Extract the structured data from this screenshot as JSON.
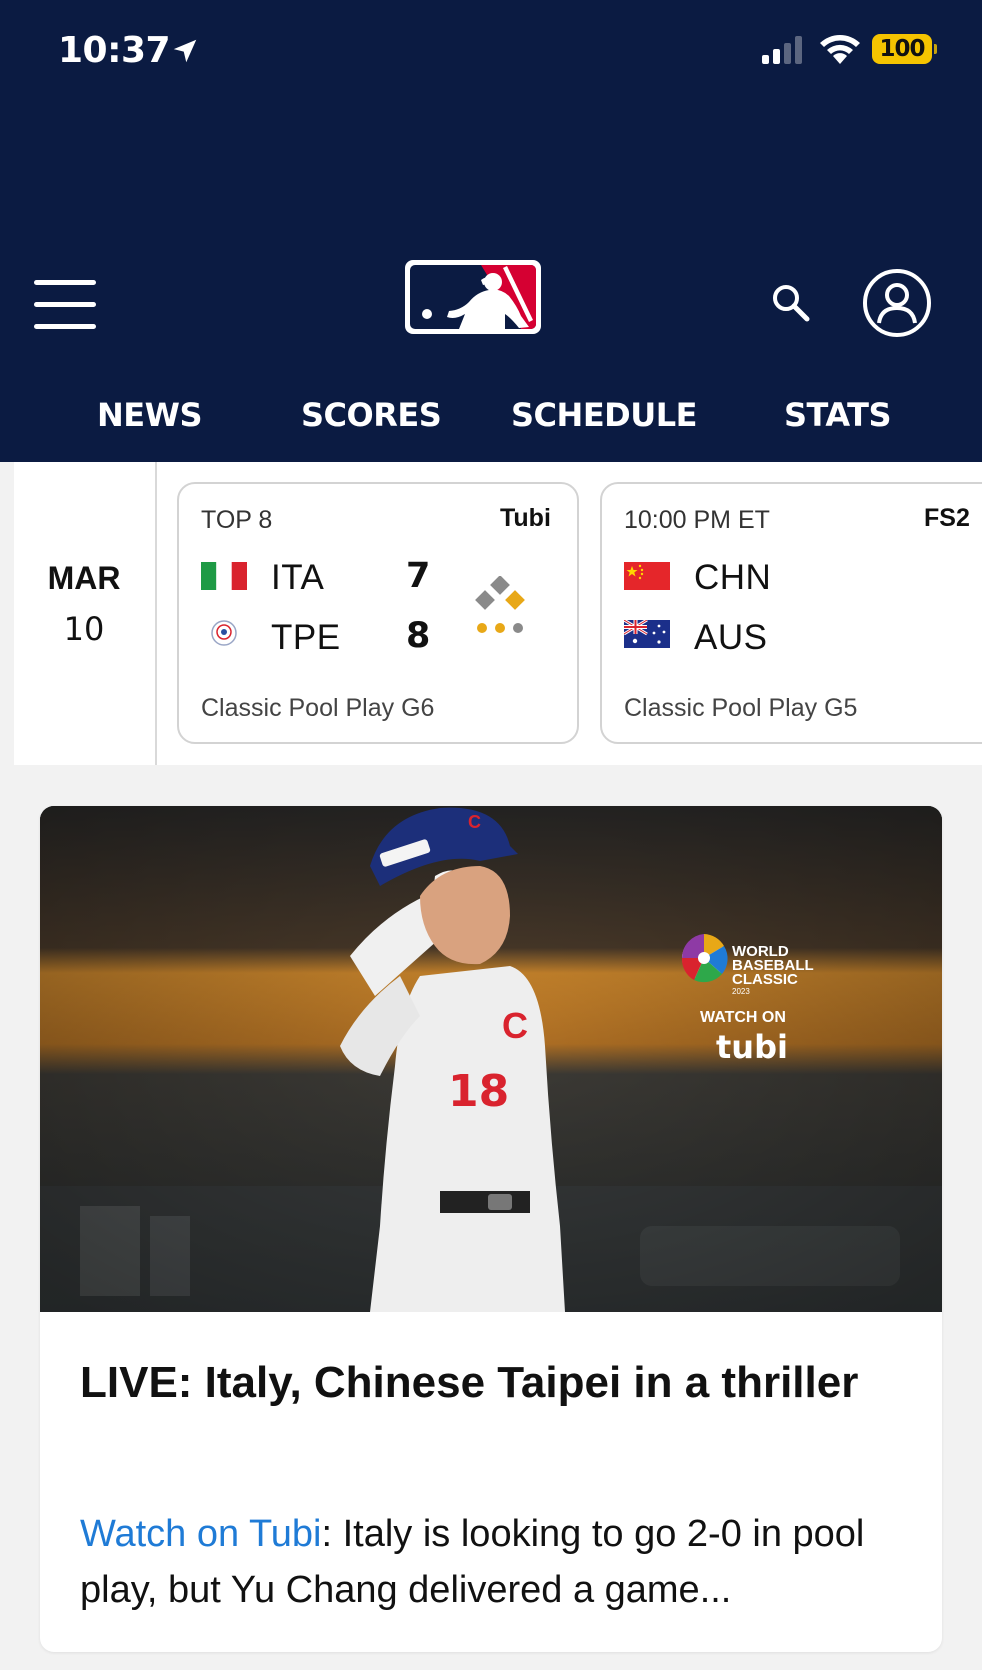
{
  "status_bar": {
    "time": "10:37",
    "battery": "100"
  },
  "nav": {
    "tabs": [
      {
        "label": "NEWS"
      },
      {
        "label": "SCORES"
      },
      {
        "label": "SCHEDULE"
      },
      {
        "label": "STATS"
      }
    ]
  },
  "scoreboard": {
    "date": {
      "month": "MAR",
      "day": "10"
    },
    "games": [
      {
        "status": "TOP 8",
        "network": "Tubi",
        "teams": [
          {
            "abbr": "ITA",
            "score": "7",
            "flag": "italy-flag-icon"
          },
          {
            "abbr": "TPE",
            "score": "8",
            "flag": "chinese-taipei-flag-icon"
          }
        ],
        "footer": "Classic Pool Play G6",
        "bases": {
          "first": false,
          "second": false,
          "third": true
        },
        "outs": 2
      },
      {
        "status": "10:00 PM ET",
        "network": "FS2",
        "teams": [
          {
            "abbr": "CHN",
            "score": "",
            "flag": "china-flag-icon"
          },
          {
            "abbr": "AUS",
            "score": "",
            "flag": "australia-flag-icon"
          }
        ],
        "footer": "Classic Pool Play G5"
      }
    ]
  },
  "article": {
    "hero_overlay": {
      "brand_line1": "WORLD",
      "brand_line2": "BASEBALL",
      "brand_line3": "CLASSIC",
      "brand_year": "2023",
      "watch_on": "WATCH ON",
      "service": "tubi",
      "jersey_number": "18"
    },
    "title": "LIVE: Italy, Chinese Taipei in a thriller",
    "link_text": "Watch on Tubi",
    "summary": ": Italy is looking to go 2-0 in pool play, but Yu Chang delivered a game..."
  },
  "colors": {
    "header_bg": "#0b1b42",
    "link": "#1f7bd6",
    "battery": "#f5c400",
    "mlb_red": "#d50032",
    "mlb_blue": "#041e42"
  }
}
